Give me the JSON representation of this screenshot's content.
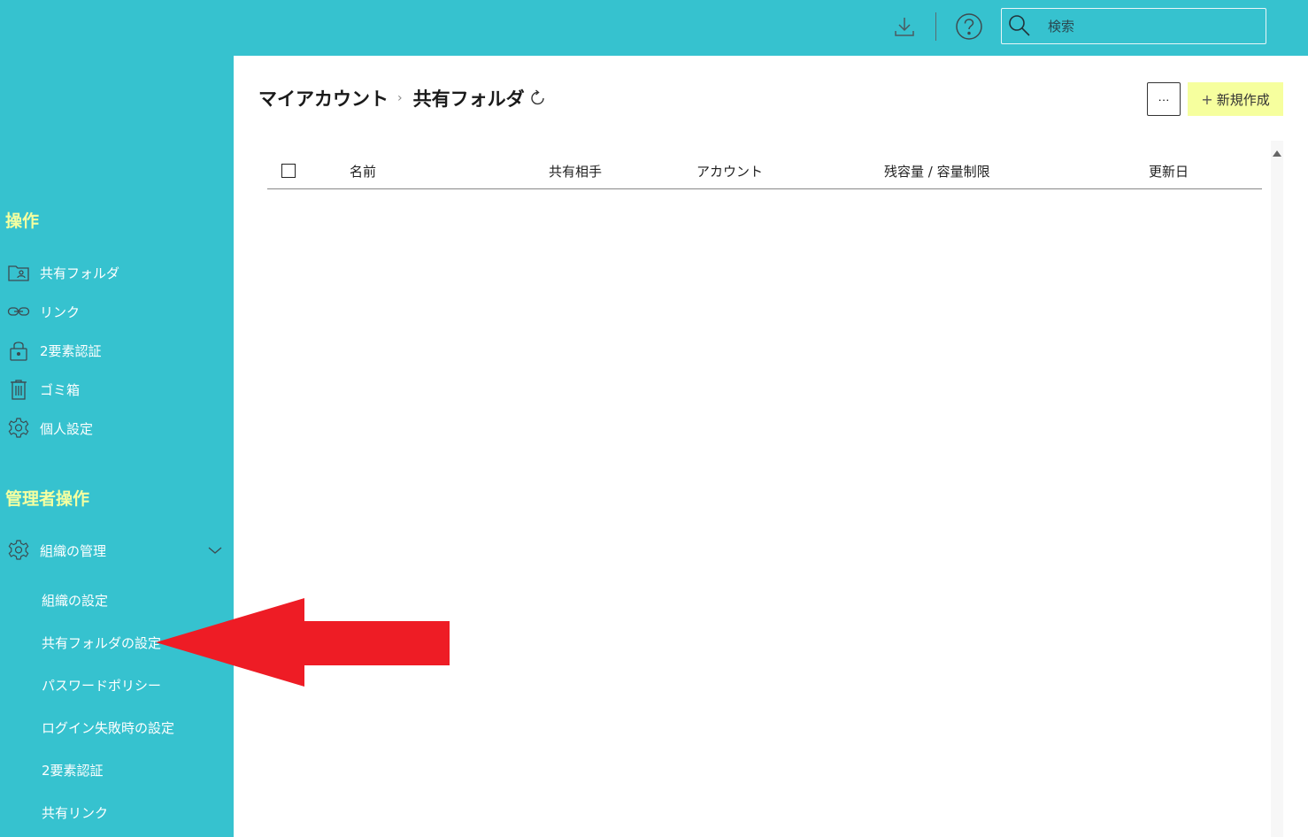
{
  "topbar": {
    "search_placeholder": "検索"
  },
  "sidebar": {
    "section_operations": "操作",
    "items": [
      {
        "label": "共有フォルダ",
        "icon": "shared-folder-icon"
      },
      {
        "label": "リンク",
        "icon": "link-icon"
      },
      {
        "label": "2要素認証",
        "icon": "lock-icon"
      },
      {
        "label": "ゴミ箱",
        "icon": "trash-icon"
      },
      {
        "label": "個人設定",
        "icon": "gear-icon"
      }
    ],
    "section_admin": "管理者操作",
    "admin_group": {
      "label": "組織の管理",
      "icon": "gear-icon"
    },
    "admin_sub_items": [
      {
        "label": "組織の設定"
      },
      {
        "label": "共有フォルダの設定"
      },
      {
        "label": "パスワードポリシー"
      },
      {
        "label": "ログイン失敗時の設定"
      },
      {
        "label": "2要素認証"
      },
      {
        "label": "共有リンク"
      }
    ]
  },
  "main": {
    "breadcrumb": [
      "マイアカウント",
      "共有フォルダ"
    ],
    "more_button": "···",
    "new_button": "新規作成",
    "columns": [
      "名前",
      "共有相手",
      "アカウント",
      "残容量 / 容量制限",
      "更新日"
    ]
  },
  "colors": {
    "sidebar_bg": "#36c2cf",
    "section_title": "#f4ffa0",
    "new_button_bg": "#f6ff9e",
    "annotation_arrow": "#ee1c25"
  }
}
